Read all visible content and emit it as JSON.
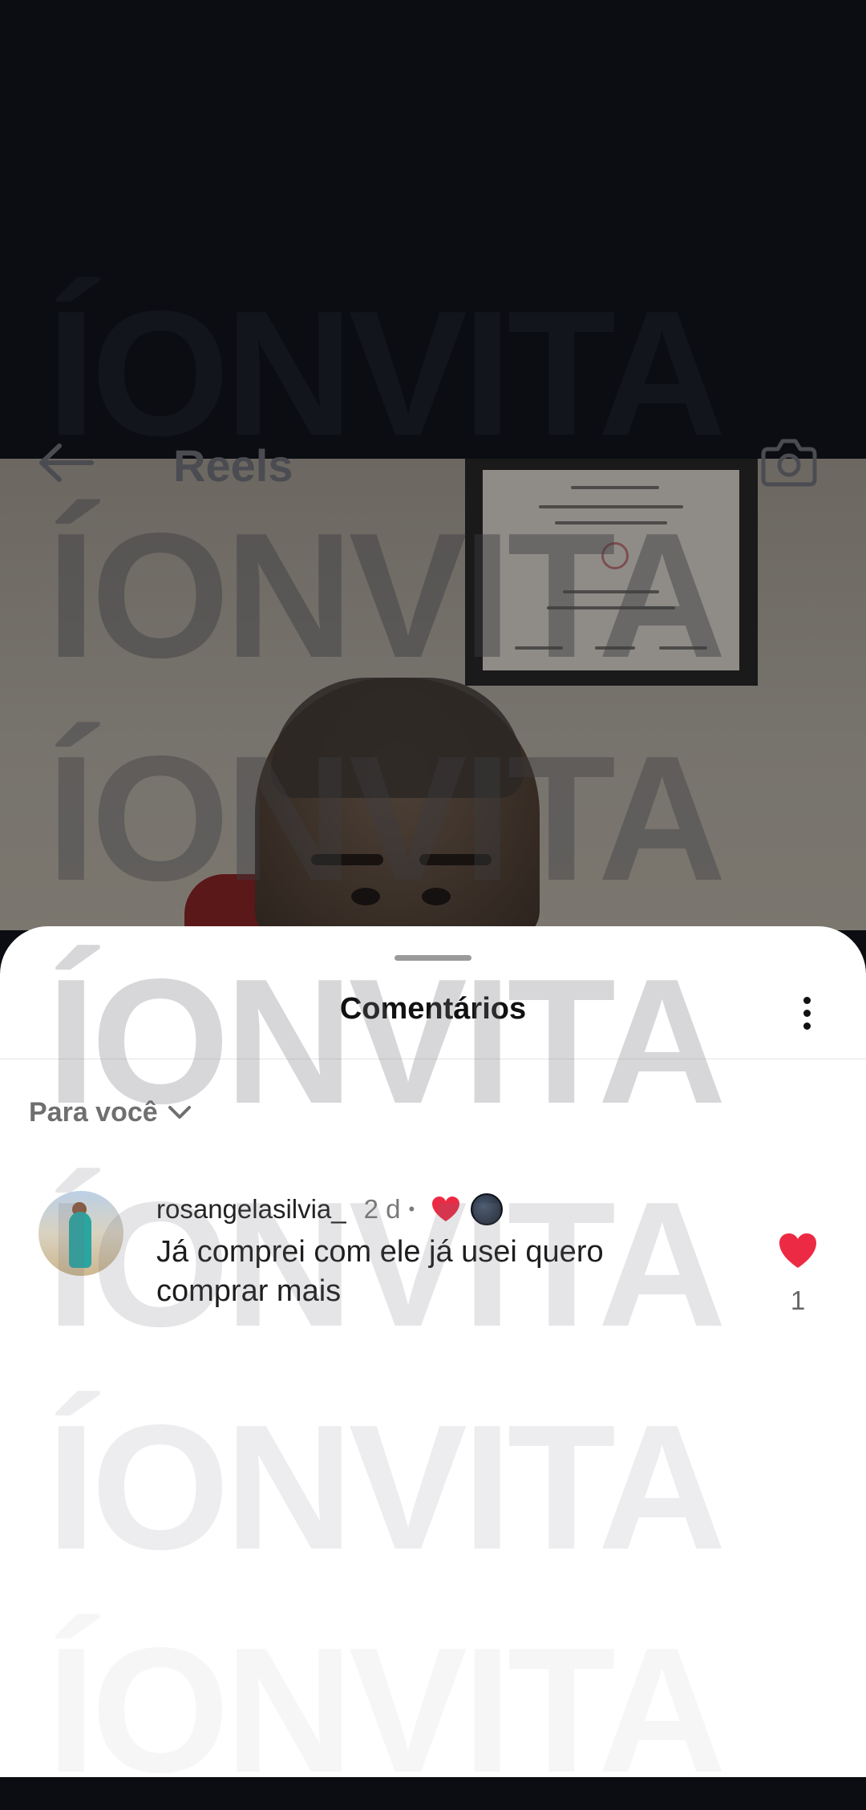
{
  "top_bar": {
    "title": "Reels",
    "back_icon": "arrow-left-icon",
    "camera_icon": "camera-icon"
  },
  "watermark": {
    "text": "ÍONVITA"
  },
  "sheet": {
    "title": "Comentários",
    "more_icon": "more-vertical-icon",
    "filter": {
      "label": "Para você",
      "icon": "chevron-down-icon"
    },
    "comments": [
      {
        "username": "rosangelasilvia_",
        "time": "2 d",
        "separator": "•",
        "text": "Já comprei com ele já usei quero comprar mais",
        "like_count": "1",
        "liked": true,
        "like_color": "#ed2a44"
      }
    ]
  },
  "colors": {
    "sheet_background": "#ffffff",
    "video_background": "#0b0d12",
    "like_red": "#ed2a44"
  }
}
